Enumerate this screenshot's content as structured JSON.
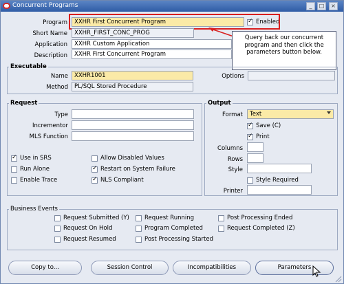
{
  "window": {
    "title": "Concurrent Programs"
  },
  "program": {
    "program_label": "Program",
    "program_value": "XXHR First Concurrent Program",
    "enabled_label": "Enabled",
    "enabled_checked": true,
    "short_name_label": "Short Name",
    "short_name_value": "XXHR_FIRST_CONC_PROG",
    "application_label": "Application",
    "application_value": "XXHR Custom Application",
    "description_label": "Description",
    "description_value": "XXHR First Concurrent Program"
  },
  "callout": {
    "text": "Query back our concurrent program and then click the parameters button below."
  },
  "executable": {
    "title": "Executable",
    "name_label": "Name",
    "name_value": "XXHR1001",
    "method_label": "Method",
    "method_value": "PL/SQL Stored Procedure",
    "options_label": "Options",
    "options_value": ""
  },
  "request": {
    "title": "Request",
    "type_label": "Type",
    "incrementor_label": "Incrementor",
    "mls_label": "MLS Function",
    "use_in_srs": "Use in SRS",
    "allow_disabled": "Allow Disabled Values",
    "run_alone": "Run Alone",
    "restart": "Restart on System Failure",
    "enable_trace": "Enable Trace",
    "nls_compliant": "NLS Compliant"
  },
  "output": {
    "title": "Output",
    "format_label": "Format",
    "format_value": "Text",
    "save_label": "Save (C)",
    "print_label": "Print",
    "columns_label": "Columns",
    "rows_label": "Rows",
    "style_label": "Style",
    "style_required": "Style Required",
    "printer_label": "Printer"
  },
  "business_events": {
    "title": "Business Events",
    "items": [
      "Request Submitted (Y)",
      "Request Running",
      "Post Processing Ended",
      "Request On Hold",
      "Program Completed",
      "Request Completed (Z)",
      "Request Resumed",
      "Post Processing Started"
    ]
  },
  "buttons": {
    "copy": "Copy to...",
    "session": "Session Control",
    "incompat": "Incompatibilities",
    "params": "Parameters"
  }
}
